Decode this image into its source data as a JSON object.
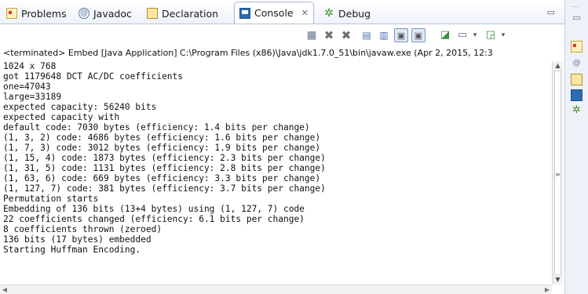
{
  "tabs": [
    {
      "label": "Problems",
      "icon": "problems-icon"
    },
    {
      "label": "Javadoc",
      "icon": "javadoc-icon"
    },
    {
      "label": "Declaration",
      "icon": "declaration-icon"
    },
    {
      "label": "Console",
      "icon": "console-icon",
      "active": true,
      "close": "✕"
    },
    {
      "label": "Debug",
      "icon": "debug-icon"
    }
  ],
  "status_line": "<terminated> Embed [Java Application] C:\\Program Files (x86)\\Java\\jdk1.7.0_51\\bin\\javaw.exe (Apr 2, 2015, 12:3",
  "console_lines": [
    "1024 x 768",
    "got 1179648 DCT AC/DC coefficients",
    "one=47043",
    "large=33189",
    "expected capacity: 56240 bits",
    "expected capacity with",
    "default code: 7030 bytes (efficiency: 1.4 bits per change)",
    "(1, 3, 2) code: 4686 bytes (efficiency: 1.6 bits per change)",
    "(1, 7, 3) code: 3012 bytes (efficiency: 1.9 bits per change)",
    "(1, 15, 4) code: 1873 bytes (efficiency: 2.3 bits per change)",
    "(1, 31, 5) code: 1131 bytes (efficiency: 2.8 bits per change)",
    "(1, 63, 6) code: 669 bytes (efficiency: 3.3 bits per change)",
    "(1, 127, 7) code: 381 bytes (efficiency: 3.7 bits per change)",
    "Permutation starts",
    "Embedding of 136 bits (13+4 bytes) using (1, 127, 7) code",
    "22 coefficients changed (efficiency: 6.1 bits per change)",
    "8 coefficients thrown (zeroed)",
    "136 bits (17 bytes) embedded",
    "Starting Huffman Encoding."
  ],
  "toolbar_icons": [
    "terminate-icon",
    "remove-launch-icon",
    "remove-all-terminated-icon",
    "clear-console-icon",
    "scroll-lock-icon",
    "show-on-stdout-icon",
    "show-on-stderr-icon",
    "pin-console-icon",
    "display-selected-console-icon",
    "open-console-icon"
  ],
  "side_icons": [
    "problems-icon",
    "javadoc-icon",
    "declaration-icon",
    "console-icon",
    "debug-icon"
  ],
  "colors": {
    "tab_bar": "#eef2f9",
    "active_tab": "#ffffff",
    "accent": "#2d6bb3"
  }
}
